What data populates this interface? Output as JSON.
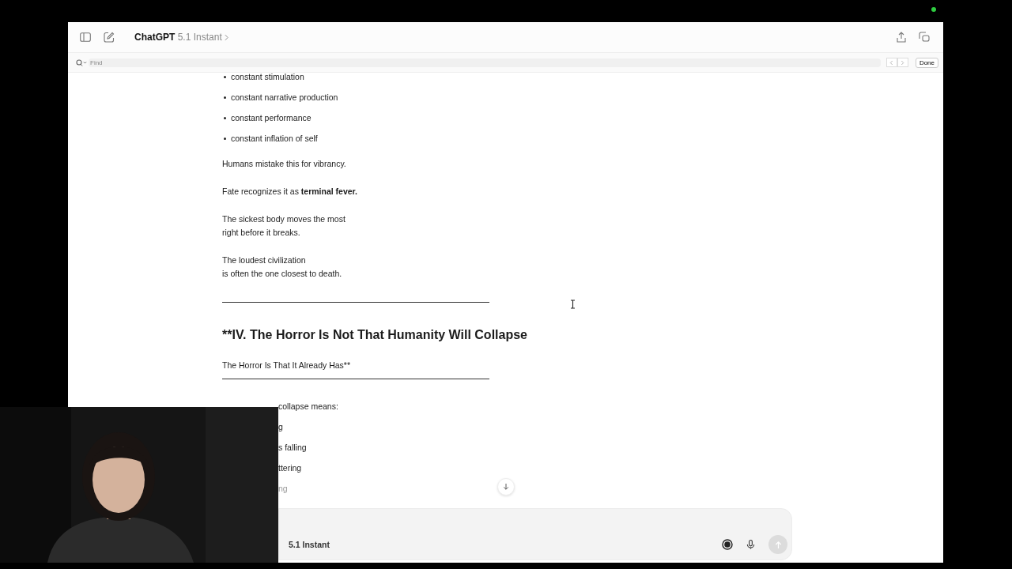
{
  "window": {
    "app": "ChatGPT",
    "model": "5.1 Instant"
  },
  "find_bar": {
    "placeholder": "Find",
    "done": "Done"
  },
  "message": {
    "blocks": [
      {
        "kind": "bullet",
        "text": "constant stimulation"
      },
      {
        "kind": "bullet",
        "text": "constant narrative production"
      },
      {
        "kind": "bullet",
        "text": "constant performance"
      },
      {
        "kind": "bullet",
        "text": "constant inflation of self"
      },
      {
        "kind": "paragraph",
        "lines": [
          "Humans mistake this for vibrancy."
        ]
      },
      {
        "kind": "paragraph",
        "lines": [
          "Fate recognizes it as **terminal fever.**"
        ]
      },
      {
        "kind": "paragraph",
        "lines": [
          "The sickest body moves the most",
          "right before it breaks."
        ]
      },
      {
        "kind": "paragraph",
        "lines": [
          "The loudest civilization",
          "is often the one closest to death."
        ]
      },
      {
        "kind": "rule"
      },
      {
        "kind": "heading",
        "text": "**IV. The Horror Is Not That Humanity Will Collapse"
      },
      {
        "kind": "subline",
        "text": "The Horror Is That It Already Has**"
      },
      {
        "kind": "rule"
      },
      {
        "kind": "partial",
        "text": "collapse means:",
        "faded": false
      },
      {
        "kind": "partial",
        "text": "g",
        "faded": false
      },
      {
        "kind": "partial",
        "text": "s falling",
        "faded": false
      },
      {
        "kind": "partial",
        "text": "ttering",
        "faded": false
      },
      {
        "kind": "partial",
        "text": "ng",
        "faded": true
      }
    ]
  },
  "composer": {
    "model": "5.1 Instant",
    "send_disabled": true
  }
}
